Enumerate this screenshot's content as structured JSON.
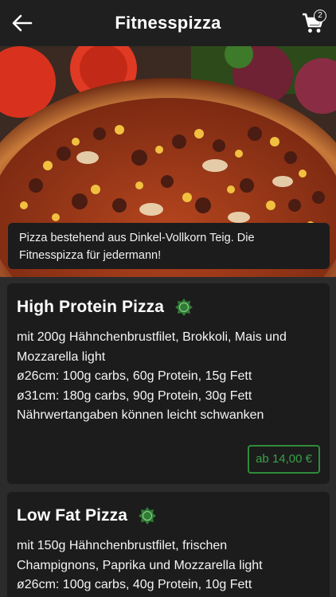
{
  "header": {
    "title": "Fitnesspizza",
    "back_icon": "arrow-left-icon",
    "cart_icon": "shopping-cart-icon",
    "cart_count": "2"
  },
  "hero": {
    "image": "pizza-photo",
    "caption": "Pizza bestehend aus Dinkel-Vollkorn Teig. Die Fitnesspizza für jedermann!"
  },
  "products": [
    {
      "name": "High Protein Pizza",
      "badge_icon": "halal-icon",
      "lines": [
        "mit 200g Hähnchenbrustfilet, Brokkoli, Mais und",
        "Mozzarella light",
        "ø26cm: 100g carbs, 60g Protein, 15g Fett",
        "ø31cm: 180g carbs, 90g Protein, 30g Fett",
        "Nährwertangaben können leicht schwanken"
      ],
      "price": "ab 14,00 €"
    },
    {
      "name": "Low Fat Pizza",
      "badge_icon": "halal-icon",
      "lines": [
        "mit 150g Hähnchenbrustfilet, frischen",
        "Champignons, Paprika und Mozzarella light",
        "ø26cm: 100g carbs, 40g Protein, 10g Fett"
      ]
    }
  ],
  "colors": {
    "background": "#2b2b2b",
    "appbar": "#1f1f1f",
    "card": "#1c1c1c",
    "accent_green": "#2f8c3a"
  }
}
